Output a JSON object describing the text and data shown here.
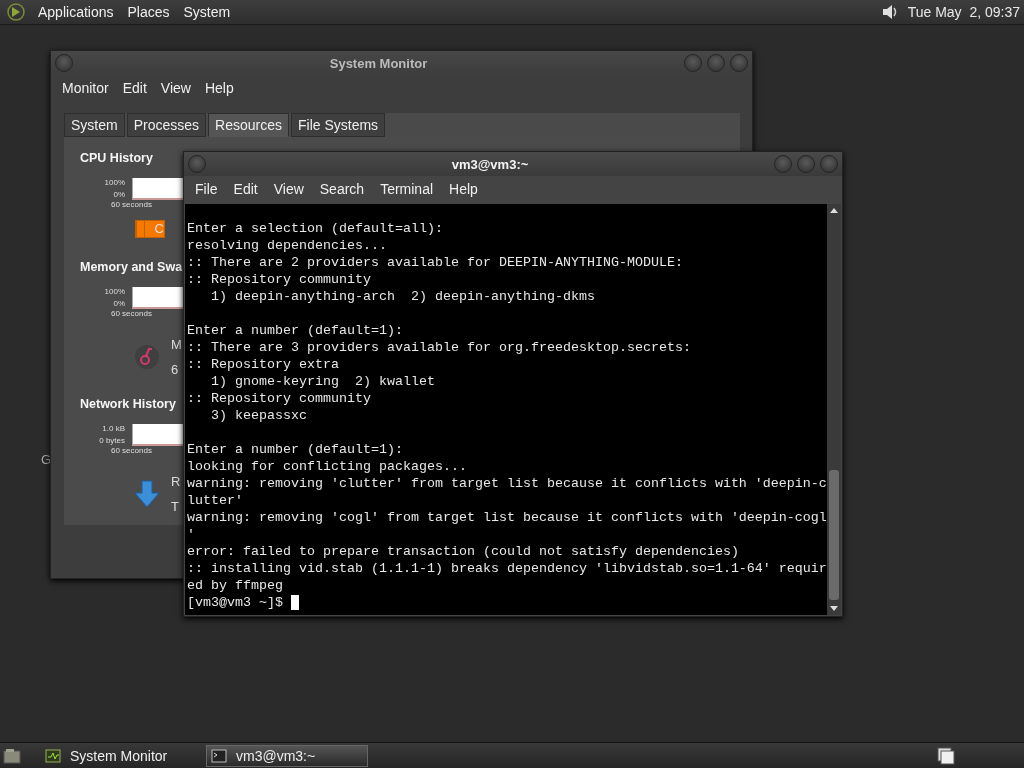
{
  "top_panel": {
    "menus": [
      "Applications",
      "Places",
      "System"
    ],
    "clock": "Tue May  2, 09:37"
  },
  "desktop_text": "G",
  "system_monitor": {
    "title": "System Monitor",
    "menus": [
      "Monitor",
      "Edit",
      "View",
      "Help"
    ],
    "tabs": [
      {
        "label": "System",
        "selected": false
      },
      {
        "label": "Processes",
        "selected": false
      },
      {
        "label": "Resources",
        "selected": true
      },
      {
        "label": "File Systems",
        "selected": false
      }
    ],
    "sections": [
      {
        "title": "CPU History",
        "graph": {
          "top_label": "100%",
          "bottom_label": "0%",
          "time_label": "60 seconds"
        },
        "legend": {
          "kind": "swatch",
          "texts": [
            "C"
          ]
        }
      },
      {
        "title": "Memory and Swa",
        "graph": {
          "top_label": "100%",
          "bottom_label": "0%",
          "time_label": "60 seconds"
        },
        "legend": {
          "kind": "gauge",
          "texts": [
            "M",
            "6"
          ]
        }
      },
      {
        "title": "Network History",
        "graph": {
          "top_label": "1.0 kB",
          "bottom_label": "0 bytes",
          "time_label": "60 seconds"
        },
        "legend": {
          "kind": "download",
          "texts": [
            "R",
            "T"
          ]
        }
      }
    ]
  },
  "terminal": {
    "title": "vm3@vm3:~",
    "menus": [
      "File",
      "Edit",
      "View",
      "Search",
      "Terminal",
      "Help"
    ],
    "blocks": [
      [
        "Enter a selection (default=all):",
        "resolving dependencies...",
        ":: There are 2 providers available for DEEPIN-ANYTHING-MODULE:",
        ":: Repository community",
        "   1) deepin-anything-arch  2) deepin-anything-dkms"
      ],
      [
        "Enter a number (default=1):",
        ":: There are 3 providers available for org.freedesktop.secrets:",
        ":: Repository extra",
        "   1) gnome-keyring  2) kwallet",
        ":: Repository community",
        "   3) keepassxc"
      ],
      [
        "Enter a number (default=1):",
        "looking for conflicting packages...",
        "warning: removing 'clutter' from target list because it conflicts with 'deepin-c",
        "lutter'",
        "warning: removing 'cogl' from target list because it conflicts with 'deepin-cogl",
        "'",
        "error: failed to prepare transaction (could not satisfy dependencies)",
        ":: installing vid.stab (1.1.1-1) breaks dependency 'libvidstab.so=1.1-64' requir",
        "ed by ffmpeg"
      ]
    ],
    "prompt": "[vm3@vm3 ~]$"
  },
  "taskbar": {
    "tasks": [
      {
        "label": "System Monitor",
        "kind": "monitor",
        "selected": false
      },
      {
        "label": "vm3@vm3:~",
        "kind": "terminal",
        "selected": true
      }
    ]
  }
}
